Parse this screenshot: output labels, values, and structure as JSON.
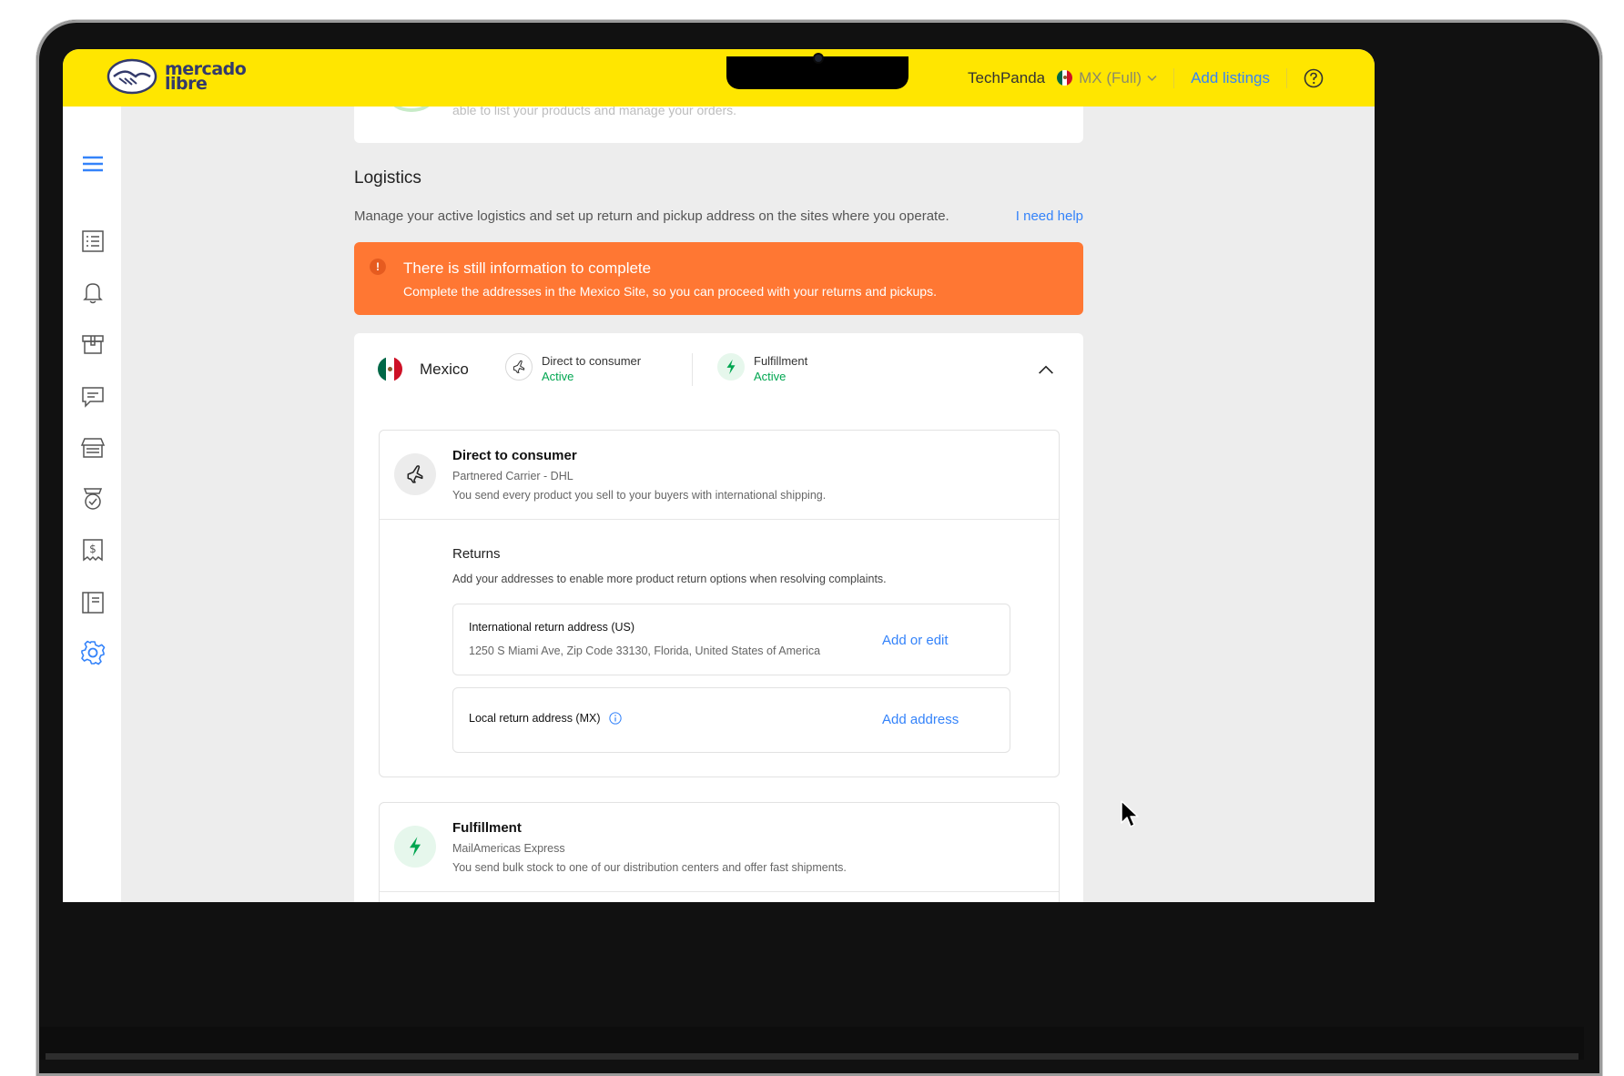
{
  "header": {
    "logo_line1": "mercado",
    "logo_line2": "libre",
    "store_name": "TechPanda",
    "site_selector": "MX (Full)",
    "add_listings": "Add listings"
  },
  "previous_card": {
    "text": "able to list your products and manage your orders."
  },
  "logistics": {
    "title": "Logistics",
    "description": "Manage your active logistics and set up return and pickup address on the sites where you operate.",
    "help_link": "I need help"
  },
  "alert": {
    "icon_glyph": "!",
    "title": "There is still information to complete",
    "message": "Complete the addresses in the Mexico Site, so you can proceed with your returns and pickups."
  },
  "country": {
    "name": "Mexico",
    "modes": [
      {
        "label": "Direct to consumer",
        "status": "Active",
        "icon": "airplane-icon"
      },
      {
        "label": "Fulfillment",
        "status": "Active",
        "icon": "lightning-icon"
      }
    ]
  },
  "direct_to_consumer": {
    "title": "Direct to consumer",
    "carrier": "Partnered Carrier - DHL",
    "description": "You send every product you sell to your buyers with international shipping.",
    "returns": {
      "title": "Returns",
      "description": "Add your addresses to enable more product return options when resolving complaints.",
      "international": {
        "label": "International return address (US)",
        "value": "1250 S Miami Ave, Zip Code 33130, Florida, United States of America",
        "action": "Add or edit"
      },
      "local": {
        "label": "Local return address (MX)",
        "action": "Add address"
      }
    }
  },
  "fulfillment": {
    "title": "Fulfillment",
    "carrier": "MailAmericas Express",
    "description": "You send bulk stock to one of our distribution centers and offer fast shipments."
  },
  "colors": {
    "brand_yellow": "#ffe600",
    "link_blue": "#3483fa",
    "alert_orange": "#ff7733",
    "active_green": "#00a650"
  },
  "sidebar_icons": [
    "menu-icon",
    "list-icon",
    "bell-icon",
    "box-icon",
    "chat-icon",
    "store-icon",
    "badge-icon",
    "receipt-icon",
    "book-icon",
    "gear-icon"
  ]
}
